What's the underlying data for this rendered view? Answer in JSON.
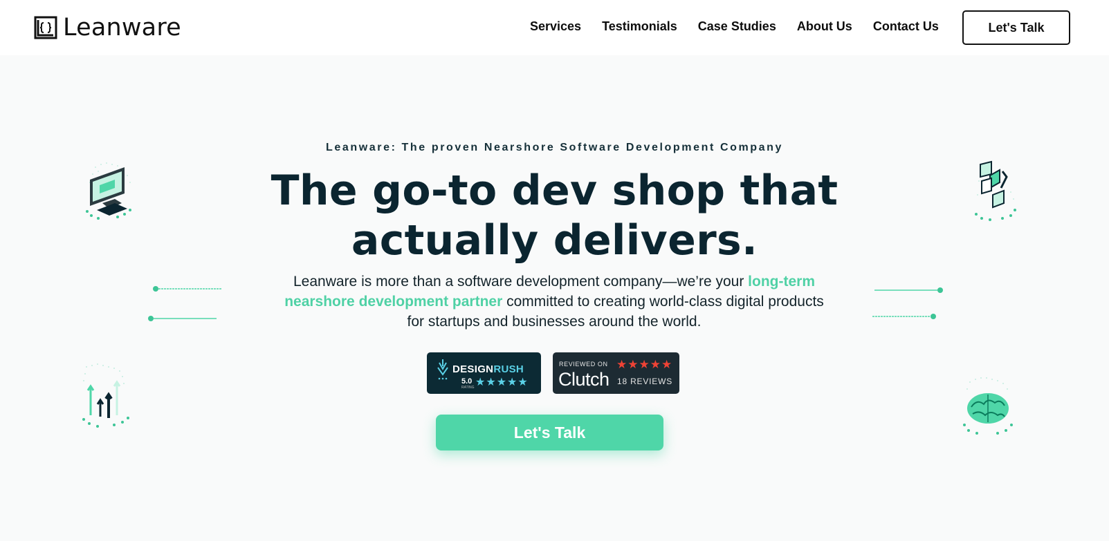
{
  "brand": {
    "name": "Leanware"
  },
  "nav": {
    "items": [
      "Services",
      "Testimonials",
      "Case Studies",
      "About Us",
      "Contact Us"
    ],
    "cta_label": "Let's Talk"
  },
  "hero": {
    "eyebrow": "Leanware: The proven Nearshore Software Development Company",
    "headline_line1": "The go-to dev shop that",
    "headline_line2": "actually delivers.",
    "sub_before": "Leanware is more than a software development company—we’re your ",
    "sub_accent": "long-term nearshore development partner",
    "sub_after": " committed to creating world-class digital products for startups and businesses around the world.",
    "cta_label": "Let's Talk"
  },
  "badges": {
    "designrush": {
      "name_part1": "DESIGN",
      "name_part2": "RUSH",
      "rating": "5.0",
      "rating_label": "RATING",
      "stars": "★★★★★"
    },
    "clutch": {
      "reviewed_label": "REVIEWED ON",
      "logo_text": "Clutch",
      "stars": "★★★★★",
      "reviews": "18 REVIEWS"
    }
  },
  "colors": {
    "accent": "#4fd6a8",
    "headline": "#0b2530",
    "badge_dark": "#0c2a34",
    "clutch_star": "#ef4335",
    "designrush_blue": "#5ad0e6"
  },
  "icons": {
    "logo_mark": "brackets-square-icon",
    "illus_top_left": "monitor-illustration",
    "illus_top_right": "puzzle-illustration",
    "illus_bottom_left": "growth-arrows-illustration",
    "illus_bottom_right": "brain-illustration"
  }
}
